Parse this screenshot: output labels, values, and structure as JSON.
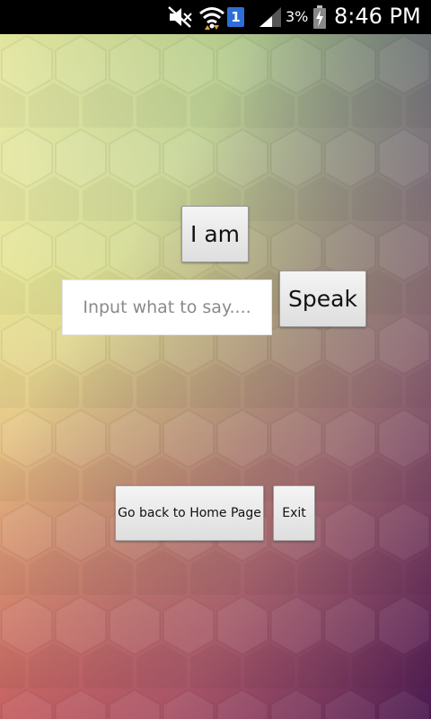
{
  "status_bar": {
    "battery_percent": "3%",
    "time": "8:46 PM",
    "sim_badge": "1",
    "icons": [
      "mute-icon",
      "wifi-icon",
      "sim-icon",
      "signal-icon",
      "battery-charging-icon"
    ]
  },
  "main": {
    "i_am_label": "I am",
    "speak_label": "Speak",
    "input": {
      "value": "",
      "placeholder": "Input what to say...."
    },
    "home_label": "Go back to Home Page",
    "exit_label": "Exit"
  },
  "colors": {
    "status_bar": "#000000",
    "bg_top_left": "#e6e69a",
    "bg_top_right": "#7c9a7c",
    "bg_bottom_left": "#e0806a",
    "bg_bottom_right": "#5a2458",
    "button_face": "#e8e8e8"
  }
}
